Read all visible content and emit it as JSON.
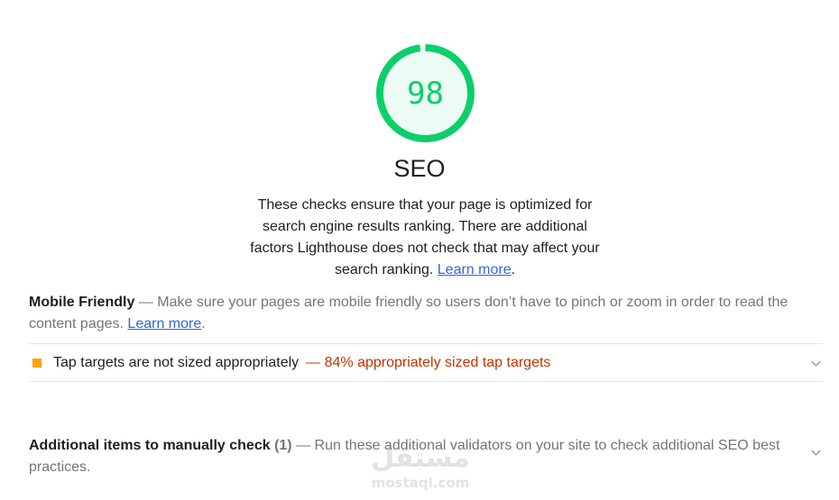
{
  "score": {
    "value": "98",
    "fraction": 0.98,
    "color": "#0cce6b"
  },
  "category": {
    "title": "SEO",
    "description": "These checks ensure that your page is optimized for search engine results ranking. There are additional factors Lighthouse does not check that may affect your search ranking.",
    "learn_more": "Learn more"
  },
  "mobile_friendly": {
    "title": "Mobile Friendly",
    "separator": "—",
    "description": "Make sure your pages are mobile friendly so users don’t have to pinch or zoom in order to read the content pages.",
    "learn_more": "Learn more"
  },
  "audit": {
    "icon": "average-square-icon",
    "icon_color": "#ffa400",
    "title": "Tap targets are not sized appropriately",
    "display_value": "— 84% appropriately sized tap targets"
  },
  "manual_check": {
    "title": "Additional items to manually check",
    "count": "(1)",
    "separator": "—",
    "description": "Run these additional validators on your site to check additional SEO best practices."
  },
  "watermark": {
    "logo": "مستقل",
    "url": "mostaql.com"
  }
}
